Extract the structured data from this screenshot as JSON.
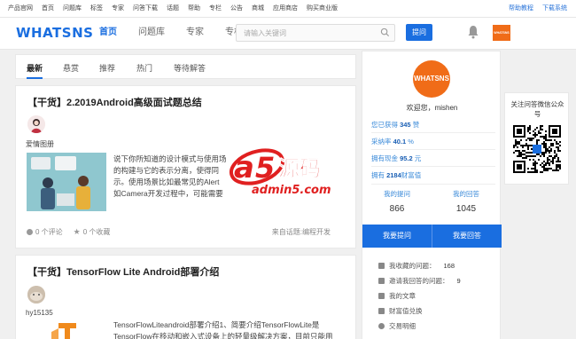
{
  "topbar": {
    "links": [
      "产品官网",
      "首页",
      "问题库",
      "标签",
      "专家",
      "问答下载",
      "话题",
      "帮助",
      "专栏",
      "公告",
      "商城",
      "应用商店",
      "购买商业版"
    ],
    "right": [
      "帮助教程",
      "下载系统"
    ]
  },
  "header": {
    "logo": "WHATSNS",
    "nav": [
      "首页",
      "问题库",
      "专家",
      "专栏"
    ],
    "search_placeholder": "请输入关键词",
    "ask_label": "提问",
    "avatar_text": "WHATSNS"
  },
  "tabs": [
    "最新",
    "悬赏",
    "推荐",
    "热门",
    "等待解答"
  ],
  "posts": [
    {
      "title": "【干货】2.2019Android高级面试题总结",
      "author": "爱情图册",
      "excerpt": [
        "说下你所知道的设计模式与使用场",
        "的构建与它的表示分离，使得同",
        "示。使用场景比如最常见的Alert",
        "如Camera开发过程中，可能需要"
      ],
      "comments": "0 个评论",
      "favorites": "0 个收藏",
      "topic": "来自话题:编程开发"
    },
    {
      "title": "【干货】TensorFlow Lite Android部署介绍",
      "author": "hy15135",
      "excerpt": [
        "TensorFlowLiteandroid部署介绍1、简要介绍TensorFlowLite是",
        "TensorFlow在移动和嵌入式设备上的轻量级解决方案，目前只能用"
      ]
    }
  ],
  "watermark": {
    "brand_a": "a",
    "brand_5": "5",
    "brand_cn": "源码",
    "domain": "admin5.com"
  },
  "sidebar": {
    "badge": "WHATSNS",
    "welcome": "欢迎您，mishen",
    "stats": [
      {
        "label": "您已获得",
        "value": "345",
        "unit": "赞"
      },
      {
        "label": "采纳率",
        "value": "40.1",
        "unit": "%"
      },
      {
        "label": "拥有现金",
        "value": "95.2",
        "unit": "元"
      },
      {
        "label": "拥有",
        "value": "2184",
        "unit": "财富值"
      }
    ],
    "my_questions_label": "我的提问",
    "my_questions": "866",
    "my_answers_label": "我的回答",
    "my_answers": "1045",
    "ask_button": "我要提问",
    "answer_button": "我要回答",
    "menu": [
      {
        "label": "我收藏的问题：",
        "num": "168"
      },
      {
        "label": "邀请我回答的问题：",
        "num": "9"
      },
      {
        "label": "我的文章",
        "num": ""
      },
      {
        "label": "财富值兑换",
        "num": ""
      },
      {
        "label": "交易明细",
        "num": ""
      }
    ]
  },
  "follow": {
    "title": "关注问答微信公众号"
  }
}
